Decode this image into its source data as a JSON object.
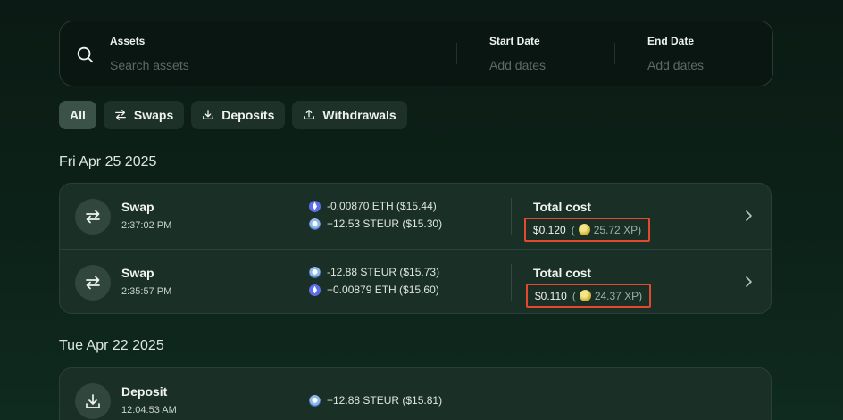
{
  "search": {
    "assets_label": "Assets",
    "assets_placeholder": "Search assets",
    "start_label": "Start Date",
    "start_placeholder": "Add dates",
    "end_label": "End Date",
    "end_placeholder": "Add dates"
  },
  "filters": {
    "all": "All",
    "swaps": "Swaps",
    "deposits": "Deposits",
    "withdrawals": "Withdrawals"
  },
  "groups": [
    {
      "date": "Fri Apr 25 2025",
      "rows": [
        {
          "type": "Swap",
          "time": "2:37:02 PM",
          "line1": "-0.00870 ETH ($15.44)",
          "line2": "+12.53 STEUR ($15.30)",
          "cost_label": "Total cost",
          "cost": "$0.120",
          "xp_open": "(",
          "xp": "25.72 XP)"
        },
        {
          "type": "Swap",
          "time": "2:35:57 PM",
          "line1": "-12.88 STEUR ($15.73)",
          "line2": "+0.00879 ETH ($15.60)",
          "cost_label": "Total cost",
          "cost": "$0.110",
          "xp_open": "(",
          "xp": "24.37 XP)"
        }
      ]
    },
    {
      "date": "Tue Apr 22 2025",
      "rows": [
        {
          "type": "Deposit",
          "time": "12:04:53 AM",
          "line1": "+12.88 STEUR ($15.81)"
        }
      ]
    }
  ],
  "colors": {
    "accent_highlight": "#e2492e",
    "card_bg": "#1a2f26",
    "active_chip": "#3a5248"
  }
}
